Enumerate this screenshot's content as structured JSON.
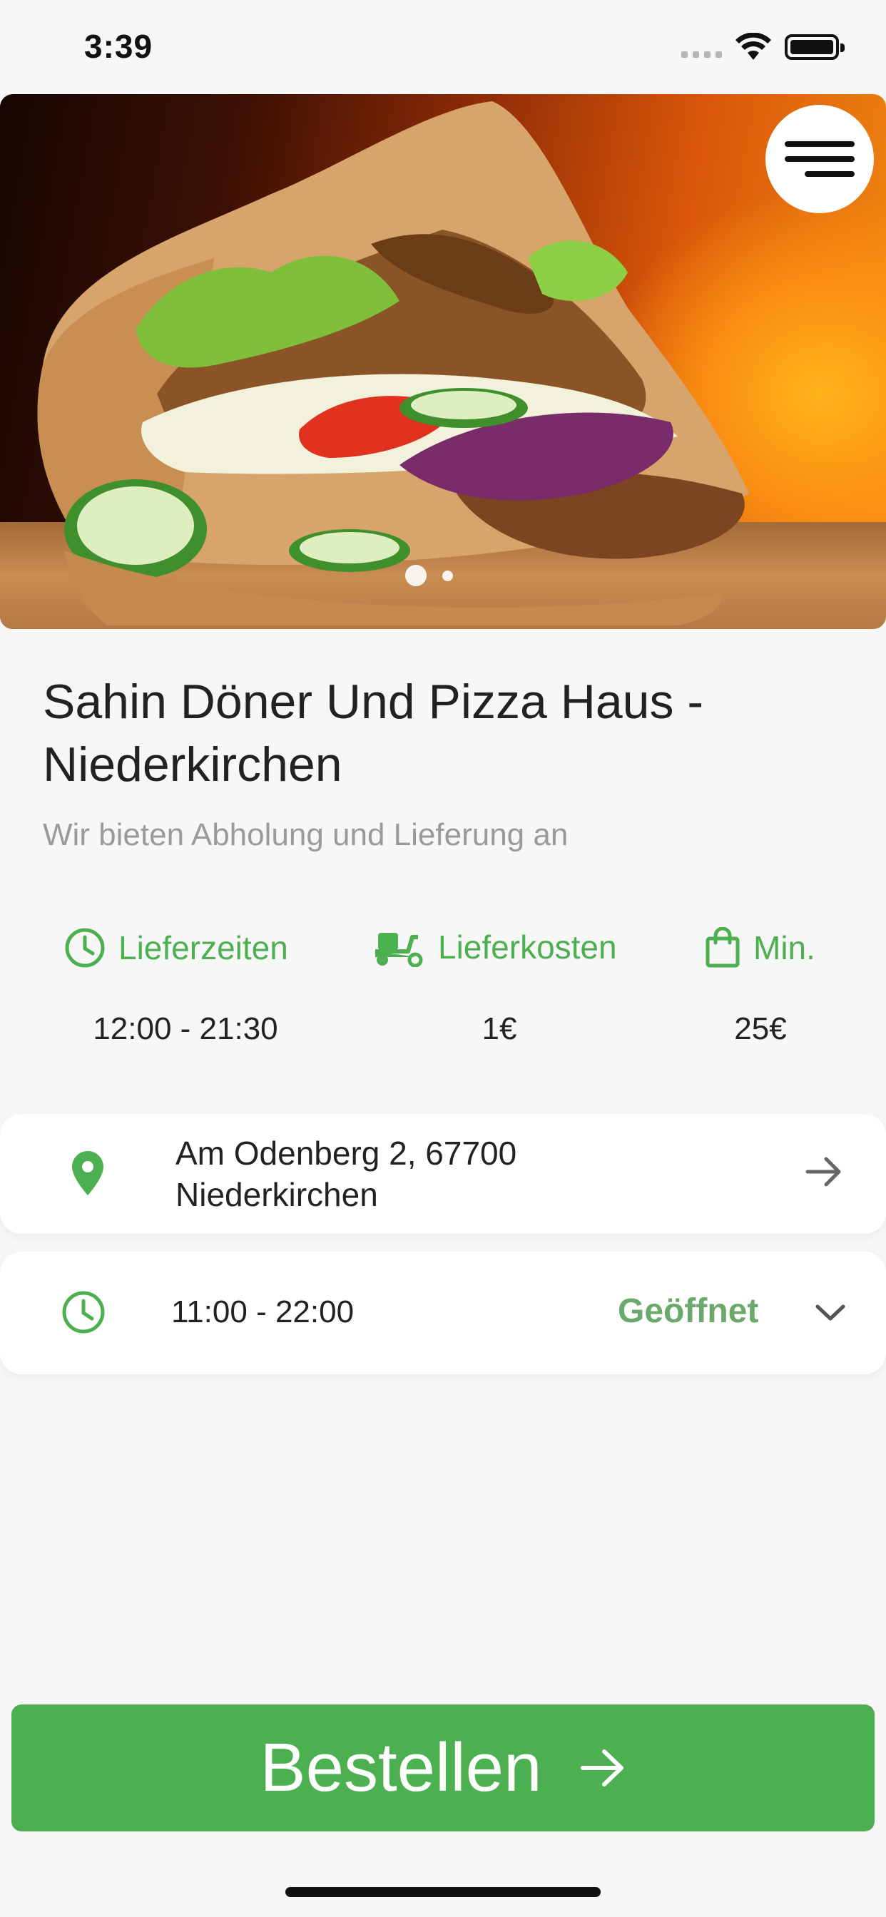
{
  "status_bar": {
    "time": "3:39"
  },
  "hero": {
    "slide_count": 2,
    "active_slide": 1
  },
  "restaurant": {
    "name": "Sahin Döner Und Pizza Haus - Niederkirchen",
    "tagline": "Wir bieten Abholung und Lieferung an"
  },
  "stats": {
    "delivery_times": {
      "label": "Lieferzeiten",
      "value": "12:00 - 21:30",
      "icon": "clock-icon"
    },
    "delivery_cost": {
      "label": "Lieferkosten",
      "value": "1€",
      "icon": "scooter-icon"
    },
    "minimum": {
      "label": "Min.",
      "value": "25€",
      "icon": "shopping-bag-icon"
    }
  },
  "address": {
    "line1": "Am Odenberg 2, 67700",
    "line2": "Niederkirchen"
  },
  "hours": {
    "time": "11:00 - 22:00",
    "status": "Geöffnet"
  },
  "cta": {
    "label": "Bestellen"
  },
  "colors": {
    "accent": "#4caf50",
    "status_open": "#6aa86c",
    "background": "#f7f7f7"
  }
}
